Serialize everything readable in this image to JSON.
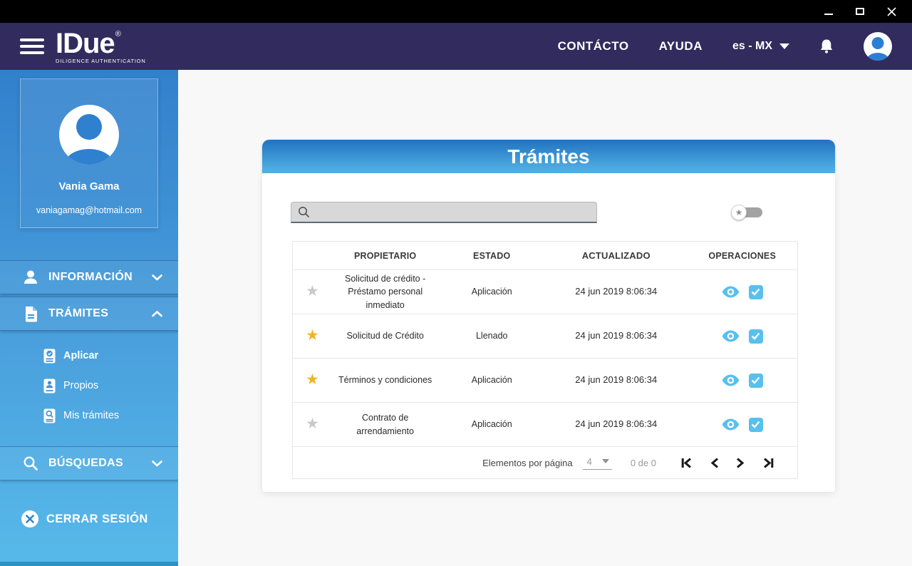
{
  "window_controls": [
    "minimize",
    "maximize",
    "close"
  ],
  "header": {
    "brand": {
      "name": "IDue",
      "registered": "®",
      "tagline": "DILIGENCE AUTHENTICATION"
    },
    "nav": {
      "contacto": "CONTÁCTO",
      "ayuda": "AYUDA"
    },
    "language": "es - MX"
  },
  "sidebar": {
    "profile": {
      "name": "Vania Gama",
      "email": "vaniagamag@hotmail.com"
    },
    "sections": {
      "informacion": {
        "label": "INFORMACIÓN",
        "state": "collapsed"
      },
      "tramites": {
        "label": "TRÁMITES",
        "state": "expanded",
        "children": {
          "aplicar": "Aplicar",
          "propios": "Propios",
          "mis_tramites": "Mis trámites"
        }
      },
      "busquedas": {
        "label": "BÚSQUEDAS",
        "state": "collapsed"
      }
    },
    "logout_label": "CERRAR SESIÓN"
  },
  "main": {
    "title": "Trámites",
    "search": {
      "value": "",
      "placeholder": ""
    },
    "table": {
      "columns": {
        "propietario": "PROPIETARIO",
        "estado": "ESTADO",
        "actualizado": "ACTUALIZADO",
        "operaciones": "OPERACIONES"
      },
      "rows": [
        {
          "favorite": false,
          "propietario": "Solicitud de crédito - Préstamo personal inmediato",
          "estado": "Aplicación",
          "actualizado": "24 jun 2019 8:06:34"
        },
        {
          "favorite": true,
          "propietario": "Solicitud de Crédito",
          "estado": "Llenado",
          "actualizado": "24 jun 2019 8:06:34"
        },
        {
          "favorite": true,
          "propietario": "Términos y condiciones",
          "estado": "Aplicación",
          "actualizado": "24 jun 2019 8:06:34"
        },
        {
          "favorite": false,
          "propietario": "Contrato de arrendamiento",
          "estado": "Aplicación",
          "actualizado": "24 jun 2019 8:06:34"
        }
      ]
    },
    "pagination": {
      "items_per_page_label": "Elementos por página",
      "items_per_page": "4",
      "range": "0 de 0"
    }
  },
  "colors": {
    "titlebar": "#000000",
    "header_bg": "#312b5e",
    "sidebar_top": "#3180cc",
    "sidebar_bottom": "#57b9ea",
    "sidebar_bottom_strip": "#2a93c4",
    "card_header_top": "#2172c1",
    "card_header_bottom": "#55b5e6",
    "accent_light_blue": "#57c0ee",
    "favorite_yellow": "#f2b32a",
    "inactive_gray": "#c9c9c9",
    "main_bg": "#f8f8f8"
  }
}
